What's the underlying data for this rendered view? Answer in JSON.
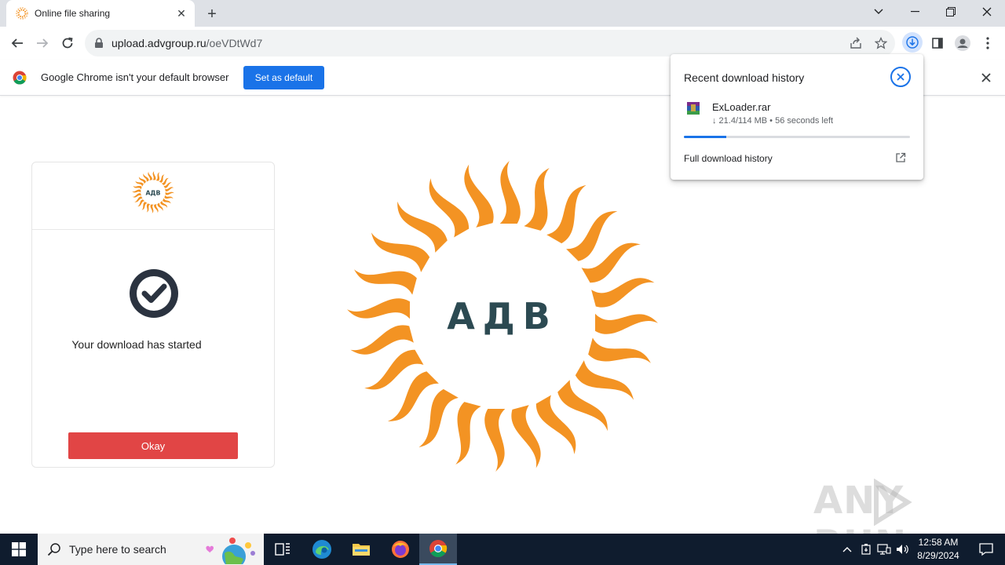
{
  "browser": {
    "tab": {
      "title": "Online file sharing"
    },
    "url": {
      "host": "upload.advgroup.ru",
      "path": "/oeVDtWd7"
    }
  },
  "infobar": {
    "message": "Google Chrome isn't your default browser",
    "button_label": "Set as default"
  },
  "download_bubble": {
    "title": "Recent download history",
    "file_name": "ExLoader.rar",
    "status": "↓ 21.4/114 MB • 56 seconds left",
    "progress": 0.188,
    "full_history_label": "Full download history"
  },
  "page": {
    "card": {
      "message": "Your download has started",
      "okay_label": "Okay"
    },
    "logo_text": "АДВ",
    "logo_text_small": "АДВ"
  },
  "watermark": {
    "left": "ANY",
    "right": "RUN"
  },
  "taskbar": {
    "search_placeholder": "Type here to search",
    "time": "12:58 AM",
    "date": "8/29/2024"
  },
  "colors": {
    "accent": "#1a73e8",
    "okay_button": "#e14545",
    "logo_orange": "#f39323",
    "logo_text": "#2c4a52"
  }
}
